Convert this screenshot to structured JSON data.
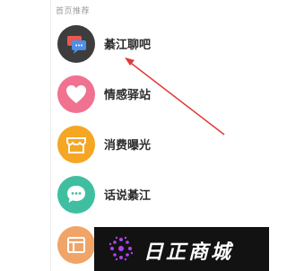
{
  "section": {
    "title": "首页推荐"
  },
  "items": [
    {
      "label": "綦江聊吧",
      "icon": "chat-bubbles-icon",
      "color": "#3d3d3d"
    },
    {
      "label": "情感驿站",
      "icon": "heart-icon",
      "color": "#f07290"
    },
    {
      "label": "消费曝光",
      "icon": "shop-icon",
      "color": "#f5a623"
    },
    {
      "label": "话说綦江",
      "icon": "speech-bubble-icon",
      "color": "#3fbfa0"
    },
    {
      "label": "",
      "icon": "newspaper-icon",
      "color": "#f0a468"
    }
  ],
  "annotation": {
    "arrow_color": "#e03a3a"
  },
  "watermark": {
    "text": "日正商城"
  }
}
